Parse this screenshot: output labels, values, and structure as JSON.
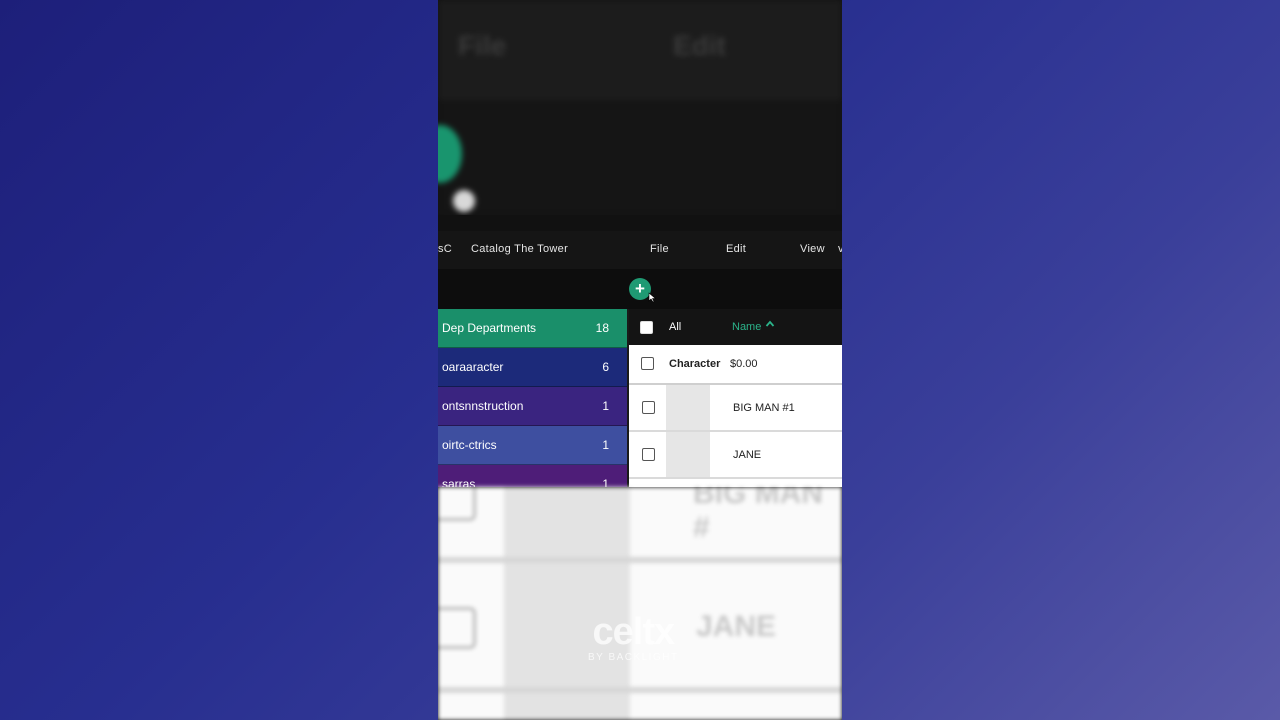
{
  "top_blur": {
    "file": "File",
    "edit": "Edit"
  },
  "menubar": {
    "partial": "sC",
    "catalog": "Catalog The Tower",
    "file": "File",
    "edit": "Edit",
    "view": "View",
    "edge": "v"
  },
  "toolbar": {
    "add_label": "+"
  },
  "departments": [
    {
      "label": "Dep Departments",
      "count": "18",
      "color": "#1a8f6a"
    },
    {
      "label": "oaraaracter",
      "count": "6",
      "color": "#1c2a7a"
    },
    {
      "label": "ontsnnstruction",
      "count": "1",
      "color": "#3a2480"
    },
    {
      "label": "oirtc-ctrics",
      "count": "1",
      "color": "#3e4fa0"
    },
    {
      "label": "sarras",
      "count": "1",
      "color": "#4e1d78"
    }
  ],
  "panel": {
    "all_label": "All",
    "name_label": "Name",
    "sort_icon": "^",
    "group": {
      "title": "Character",
      "amount": "$0.00"
    },
    "items": [
      {
        "name": "BIG MAN #1"
      },
      {
        "name": "JANE"
      }
    ]
  },
  "bottom_blur": {
    "t1": "BIG MAN #",
    "t2": "JANE"
  },
  "watermark": {
    "brand": "celtx",
    "sub": "BY BACKLIGHT"
  }
}
